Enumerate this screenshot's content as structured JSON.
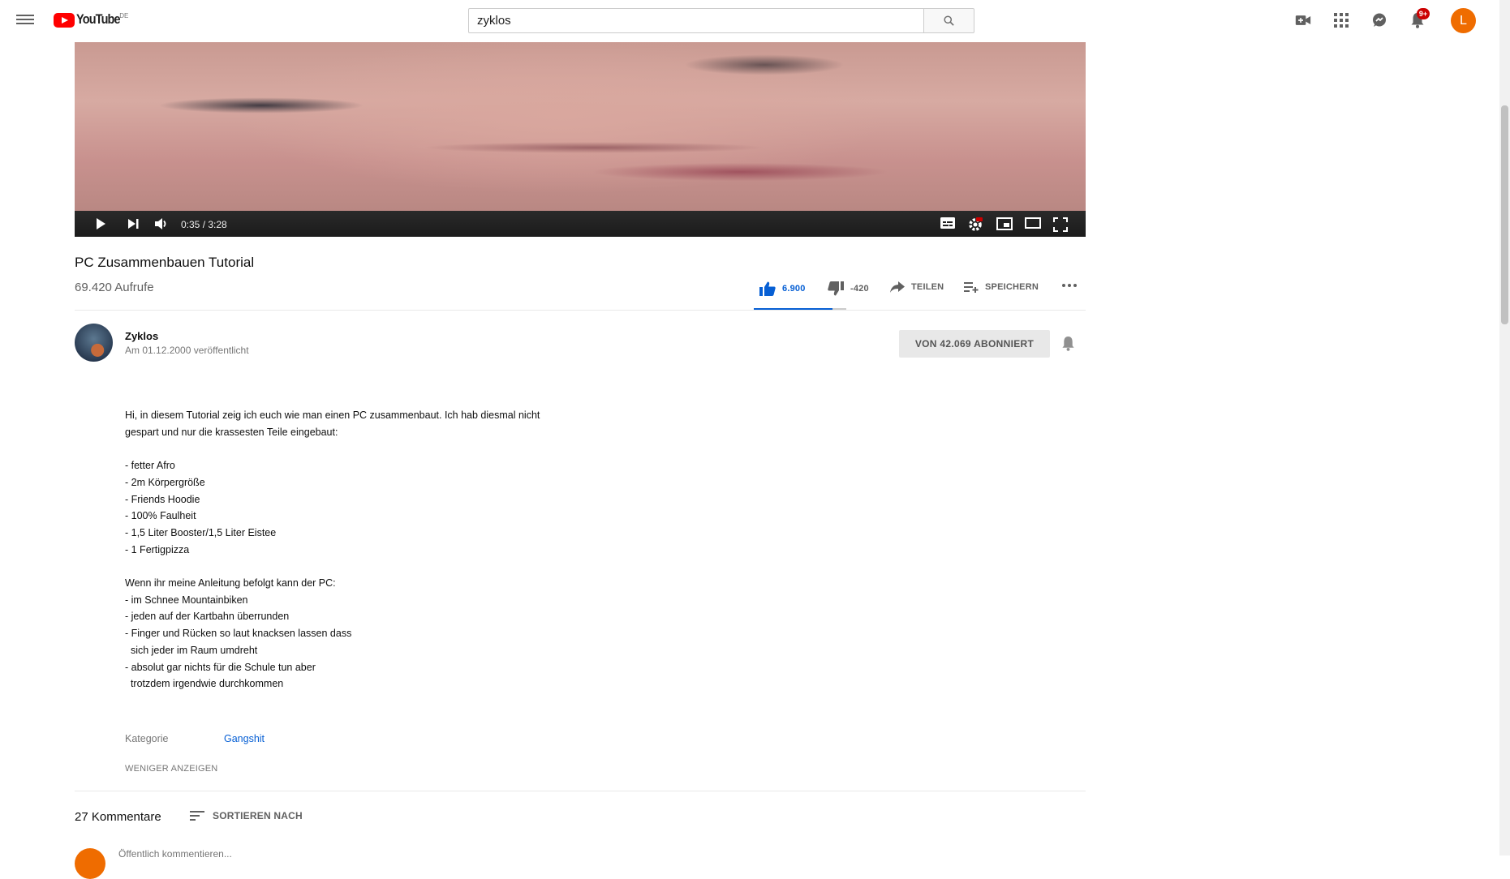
{
  "header": {
    "logo_text": "YouTube",
    "logo_country": "DE",
    "search_value": "zyklos",
    "notification_count": "9+",
    "avatar_letter": "L"
  },
  "player": {
    "time": "0:35 / 3:28"
  },
  "video": {
    "title": "PC Zusammenbauen Tutorial",
    "views": "69.420 Aufrufe",
    "likes": "6.900",
    "dislikes": "-420",
    "share_label": "TEILEN",
    "save_label": "SPEICHERN",
    "like_ratio": 0.85
  },
  "channel": {
    "name": "Zyklos",
    "published": "Am 01.12.2000 veröffentlicht",
    "subscribe_label": "VON  42.069 ABONNIERT"
  },
  "description": {
    "lines": [
      "Hi, in diesem Tutorial zeig ich euch wie man einen PC zusammenbaut. Ich hab diesmal nicht",
      "gespart und nur die krassesten Teile eingebaut:",
      "",
      "- fetter Afro",
      "- 2m Körpergröße",
      "- Friends Hoodie",
      "- 100% Faulheit",
      "- 1,5 Liter Booster/1,5 Liter Eistee",
      "- 1 Fertigpizza",
      "",
      "Wenn ihr meine Anleitung befolgt kann der PC:",
      "- im Schnee Mountainbiken",
      "- jeden auf der Kartbahn überrunden",
      "- Finger und Rücken so laut knacksen lassen dass",
      "  sich jeder im Raum umdreht",
      "- absolut gar nichts für die Schule tun aber",
      "  trotzdem irgendwie durchkommen"
    ],
    "category_label": "Kategorie",
    "category_value": "Gangshit",
    "show_less_label": "WENIGER ANZEIGEN"
  },
  "comments": {
    "count_label": "27 Kommentare",
    "sort_label": "SORTIEREN NACH",
    "input_placeholder": "Öffentlich kommentieren..."
  },
  "colors": {
    "brand_red": "#ff0000",
    "link_blue": "#065fd4",
    "avatar_orange": "#ef6c00"
  }
}
